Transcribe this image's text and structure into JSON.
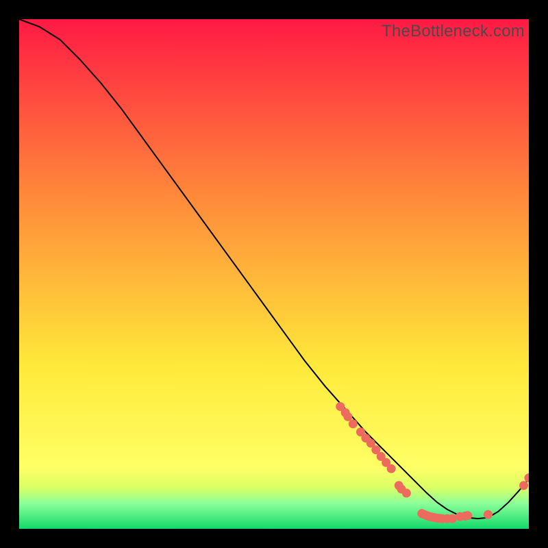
{
  "watermark": "TheBottleneck.com",
  "colors": {
    "curve": "#000000",
    "marker_fill": "#ed6a5e",
    "marker_stroke": "#ed6a5e",
    "gradient_top": "#ff1a44",
    "gradient_mid1": "#ff8a3a",
    "gradient_mid2": "#ffe93a",
    "gradient_band1": "#d8ff66",
    "gradient_band2": "#8cff9a",
    "gradient_bottom": "#12d96a"
  },
  "chart_data": {
    "type": "line",
    "xlabel": "",
    "ylabel": "",
    "xlim": [
      0,
      100
    ],
    "ylim": [
      0,
      100
    ],
    "curve": {
      "x": [
        0,
        4,
        8,
        12,
        16,
        20,
        24,
        28,
        32,
        36,
        40,
        44,
        48,
        52,
        56,
        60,
        64,
        68,
        72,
        76,
        78,
        80,
        82,
        84,
        86,
        88,
        90,
        92,
        94,
        96,
        98,
        100
      ],
      "y": [
        100,
        98.5,
        96,
        92,
        87.5,
        82.5,
        77,
        71.5,
        66,
        60.5,
        55,
        49.5,
        44,
        38.5,
        33,
        28,
        23.5,
        19,
        15,
        11,
        9,
        7,
        5.2,
        3.8,
        2.8,
        2.2,
        2,
        2.2,
        3.4,
        5.2,
        7.4,
        9.8
      ]
    },
    "markers": [
      {
        "x": 63,
        "y": 24
      },
      {
        "x": 64,
        "y": 22.8
      },
      {
        "x": 64.5,
        "y": 22
      },
      {
        "x": 65.5,
        "y": 20.6
      },
      {
        "x": 67,
        "y": 19
      },
      {
        "x": 68,
        "y": 17.8
      },
      {
        "x": 69,
        "y": 16.8
      },
      {
        "x": 70,
        "y": 15.5
      },
      {
        "x": 71,
        "y": 14.2
      },
      {
        "x": 72,
        "y": 13
      },
      {
        "x": 73,
        "y": 11.8
      },
      {
        "x": 74.5,
        "y": 8.5
      },
      {
        "x": 75,
        "y": 7.8
      },
      {
        "x": 76,
        "y": 7
      },
      {
        "x": 79,
        "y": 3
      },
      {
        "x": 79.5,
        "y": 2.8
      },
      {
        "x": 80,
        "y": 2.6
      },
      {
        "x": 80.5,
        "y": 2.4
      },
      {
        "x": 81,
        "y": 2.3
      },
      {
        "x": 81.5,
        "y": 2.2
      },
      {
        "x": 82,
        "y": 2.1
      },
      {
        "x": 82.5,
        "y": 2.05
      },
      {
        "x": 83,
        "y": 2.0
      },
      {
        "x": 84,
        "y": 2.0
      },
      {
        "x": 85,
        "y": 2.0
      },
      {
        "x": 86.5,
        "y": 2.4
      },
      {
        "x": 87.5,
        "y": 2.5
      },
      {
        "x": 88,
        "y": 2.6
      },
      {
        "x": 92,
        "y": 2.8
      },
      {
        "x": 99,
        "y": 8.5
      },
      {
        "x": 100,
        "y": 10
      }
    ],
    "marker_radius": 6
  }
}
